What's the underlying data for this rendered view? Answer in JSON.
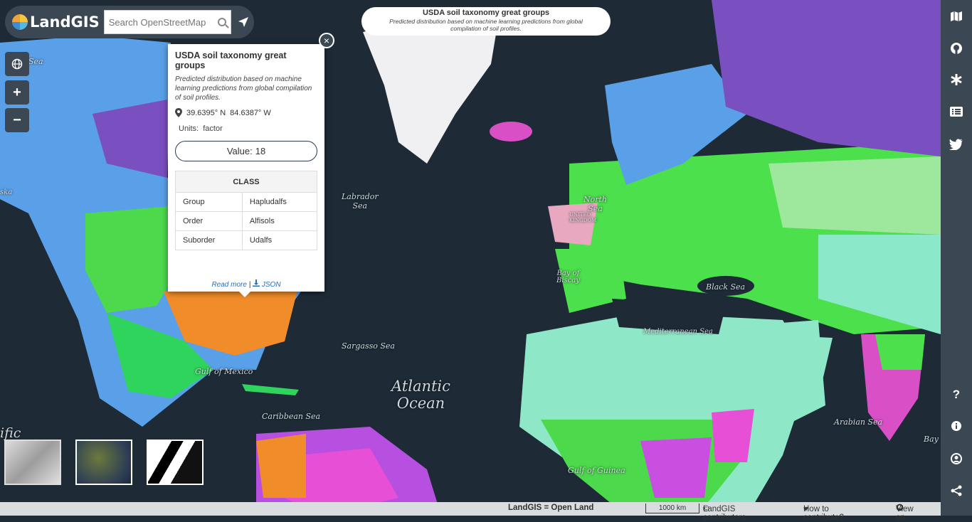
{
  "app": {
    "name": "LandGIS"
  },
  "search": {
    "placeholder": "Search OpenStreetMap"
  },
  "layer_title": {
    "title": "USDA soil taxonomy great groups",
    "subtitle": "Predicted distribution based on machine learning predictions from global compilation of soil profiles."
  },
  "popup": {
    "title": "USDA soil taxonomy great groups",
    "description": "Predicted distribution based on machine learning predictions from global compilation of soil profiles.",
    "lat": "39.6395° N",
    "lon": "84.6387° W",
    "units_label": "Units:",
    "units_value": "factor",
    "value_label": "Value:",
    "value": "18",
    "class_header": "CLASS",
    "rows": [
      {
        "key": "Group",
        "value": "Hapludalfs"
      },
      {
        "key": "Order",
        "value": "Alfisols"
      },
      {
        "key": "Suborder",
        "value": "Udalfs"
      }
    ],
    "read_more": "Read more",
    "separator": "|",
    "json_link": "JSON",
    "close": "×"
  },
  "map_labels": {
    "sea1": "Sea",
    "ska": "ska",
    "labrador": "Labrador\nSea",
    "north_sea": "North\nSea",
    "united_kingdom": "UNITED\nKINGDOM",
    "biscay": "Bay of\nBiscay",
    "black_sea": "Black Sea",
    "mediterranean": "Mediterranean Sea",
    "sargasso": "Sargasso Sea",
    "gulf_mexico": "Gulf of Mexico",
    "caribbean": "Caribbean Sea",
    "atlantic": "Atlantic\nOcean",
    "arabian": "Arabian Sea",
    "guinea": "Gulf of Guinea",
    "bay": "Bay",
    "pacific": "ific"
  },
  "controls": {
    "zoom_in": "+",
    "zoom_out": "−"
  },
  "sidebar_icons": [
    "map-icon",
    "github-icon",
    "asterisk-icon",
    "list-icon",
    "twitter-icon",
    "help-icon",
    "info-icon",
    "user-icon",
    "share-icon"
  ],
  "footer": {
    "open_land": "LandGIS = Open Land",
    "scale": "1000 km",
    "contributors": "LandGIS contributors",
    "contribute": "How to contribute?",
    "view_on": "View on"
  }
}
